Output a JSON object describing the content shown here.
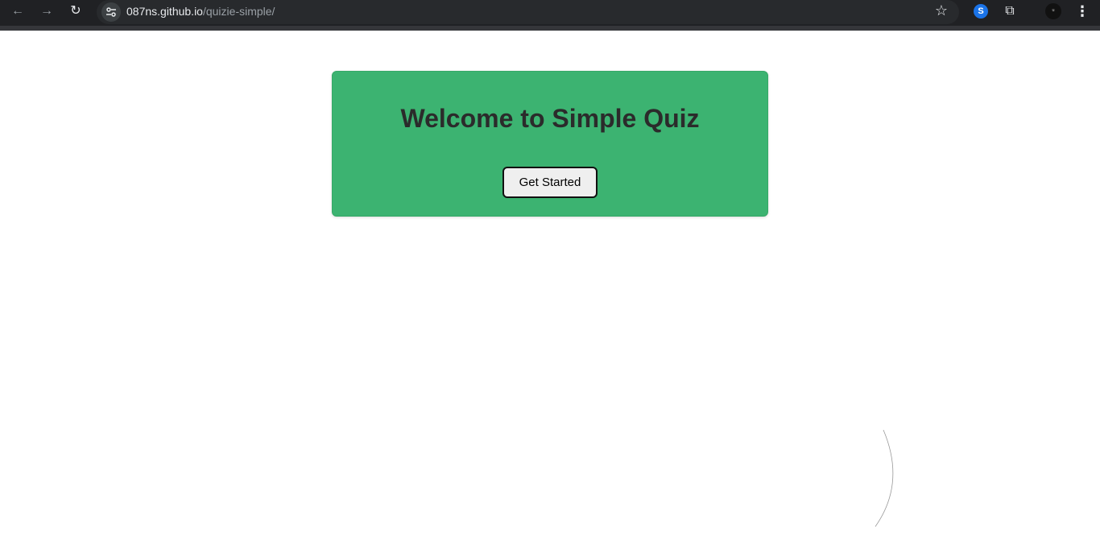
{
  "browser": {
    "back_icon": "←",
    "forward_icon": "→",
    "reload_icon": "↻",
    "url_host": "087ns.github.io",
    "url_path": "/quizie-simple/",
    "bookmark_icon": "☆",
    "extension_shazam_icon": "S",
    "extensions_icon": "⧉",
    "profile_initial": "ᵘ",
    "menu_icon": "⋮"
  },
  "card": {
    "title": "Welcome to Simple Quiz",
    "button_label": "Get Started",
    "background_color": "#3cb371"
  }
}
